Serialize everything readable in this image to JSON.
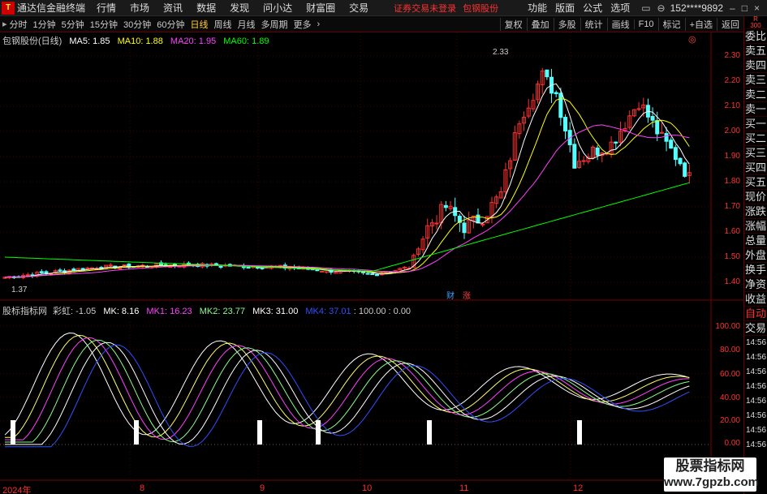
{
  "topbar": {
    "app_title": "通达信金融终端",
    "menus": [
      "行情",
      "市场",
      "资讯",
      "数据",
      "发现",
      "问小达",
      "财富圈",
      "交易"
    ],
    "alert": "证券交易未登录",
    "alert_stock": "包钢股份",
    "right_menus": [
      "功能",
      "版面",
      "公式",
      "选项"
    ],
    "account": "152****9892"
  },
  "period_bar": {
    "periods": [
      "分时",
      "1分钟",
      "5分钟",
      "15分钟",
      "30分钟",
      "60分钟",
      "日线",
      "周线",
      "月线",
      "多周期",
      "更多"
    ],
    "active": "日线",
    "tools": [
      "复权",
      "叠加",
      "多股",
      "统计",
      "画线",
      "F10",
      "标记",
      "+自选",
      "返回"
    ]
  },
  "main_legend": {
    "name": "包钢股份(日线)",
    "ma5": "MA5: 1.85",
    "ma10": "MA10: 1.88",
    "ma20": "MA20: 1.95",
    "ma60": "MA60: 1.89"
  },
  "price_axis": [
    "2.30",
    "2.20",
    "2.10",
    "2.00",
    "1.90",
    "1.80",
    "1.70",
    "1.60",
    "1.50",
    "1.40"
  ],
  "high_label": "2.33",
  "low_label": "1.37",
  "badges": {
    "cai": "财",
    "zhang": "涨"
  },
  "sub_legend": {
    "name": "股标指标网",
    "rainbow": "彩虹: -1.05",
    "mk": "MK: 8.16",
    "mk1": "MK1: 16.23",
    "mk2": "MK2: 23.77",
    "mk3": "MK3: 31.00",
    "mk4": "MK4: 37.01",
    "tail": ": 100.00  : 0.00"
  },
  "sub_axis": [
    "100.00",
    "80.00",
    "60.00",
    "40.00",
    "20.00",
    "0.00"
  ],
  "dates": [
    "2024年",
    "8",
    "9",
    "10",
    "11",
    "12"
  ],
  "side": {
    "r": "R",
    "r_val": "300",
    "items": [
      "委比",
      "卖五",
      "卖四",
      "卖三",
      "卖二",
      "卖一",
      "买一",
      "买二",
      "买三",
      "买四",
      "买五",
      "现价",
      "涨跌",
      "涨幅",
      "总量",
      "外盘",
      "换手",
      "净资",
      "收益"
    ],
    "auto": "自动",
    "trade": "交易",
    "times": [
      "14:56",
      "14:56",
      "14:56",
      "14:56",
      "14:56",
      "14:56",
      "14:56",
      "14:56"
    ]
  },
  "watermark": {
    "line1": "股票指标网",
    "line2": "www.7gpzb.com"
  },
  "colors": {
    "up": "#ff3030",
    "down": "#54ffff",
    "ma5": "#ffffff",
    "ma10": "#ffff00",
    "ma20": "#ff40ff",
    "ma60": "#00ff00"
  }
}
